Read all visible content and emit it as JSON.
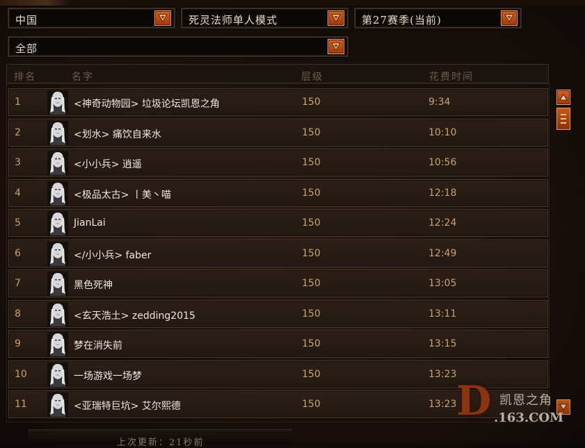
{
  "filters": {
    "region": "中国",
    "mode": "死灵法师单人模式",
    "season": "第27赛季(当前)",
    "scope": "全部"
  },
  "columns": {
    "rank": "排名",
    "name": "名字",
    "tier": "层级",
    "time": "花费时间"
  },
  "rows": [
    {
      "rank": "1",
      "name": "<神奇动物园> 垃圾论坛凯恩之角",
      "tier": "150",
      "time": "9:34"
    },
    {
      "rank": "2",
      "name": "<划水> 痛饮自来水",
      "tier": "150",
      "time": "10:10"
    },
    {
      "rank": "3",
      "name": "<小小兵> 逍遥",
      "tier": "150",
      "time": "10:56"
    },
    {
      "rank": "4",
      "name": "<极品太古> 丨美丶喵",
      "tier": "150",
      "time": "12:18"
    },
    {
      "rank": "5",
      "name": "JianLai",
      "tier": "150",
      "time": "12:24"
    },
    {
      "rank": "6",
      "name": "</小小兵> faber",
      "tier": "150",
      "time": "12:49"
    },
    {
      "rank": "7",
      "name": "黑色死神",
      "tier": "150",
      "time": "13:05"
    },
    {
      "rank": "8",
      "name": "<玄天浩土> zedding2015",
      "tier": "150",
      "time": "13:11"
    },
    {
      "rank": "9",
      "name": "梦在消失前",
      "tier": "150",
      "time": "13:15"
    },
    {
      "rank": "10",
      "name": "一场游戏一场梦",
      "tier": "150",
      "time": "13:23"
    },
    {
      "rank": "11",
      "name": "<亚瑞特巨坑> 艾尔熙德",
      "tier": "150",
      "time": "13:23"
    }
  ],
  "footer": {
    "last_updated": "上次更新：21秒前"
  },
  "watermark": {
    "letter": "D",
    "site_name": "凯恩之角",
    "domain": ".163.COM"
  },
  "colors": {
    "accent": "#c4501a",
    "value_text": "#c8a46a",
    "name_text": "#f0e8dc"
  },
  "icons": {
    "dropdown": "chevron-down-icon",
    "scroll_up": "chevron-up-icon",
    "scroll_thumb": "grip-icon",
    "avatar": "necromancer-portrait-icon"
  }
}
